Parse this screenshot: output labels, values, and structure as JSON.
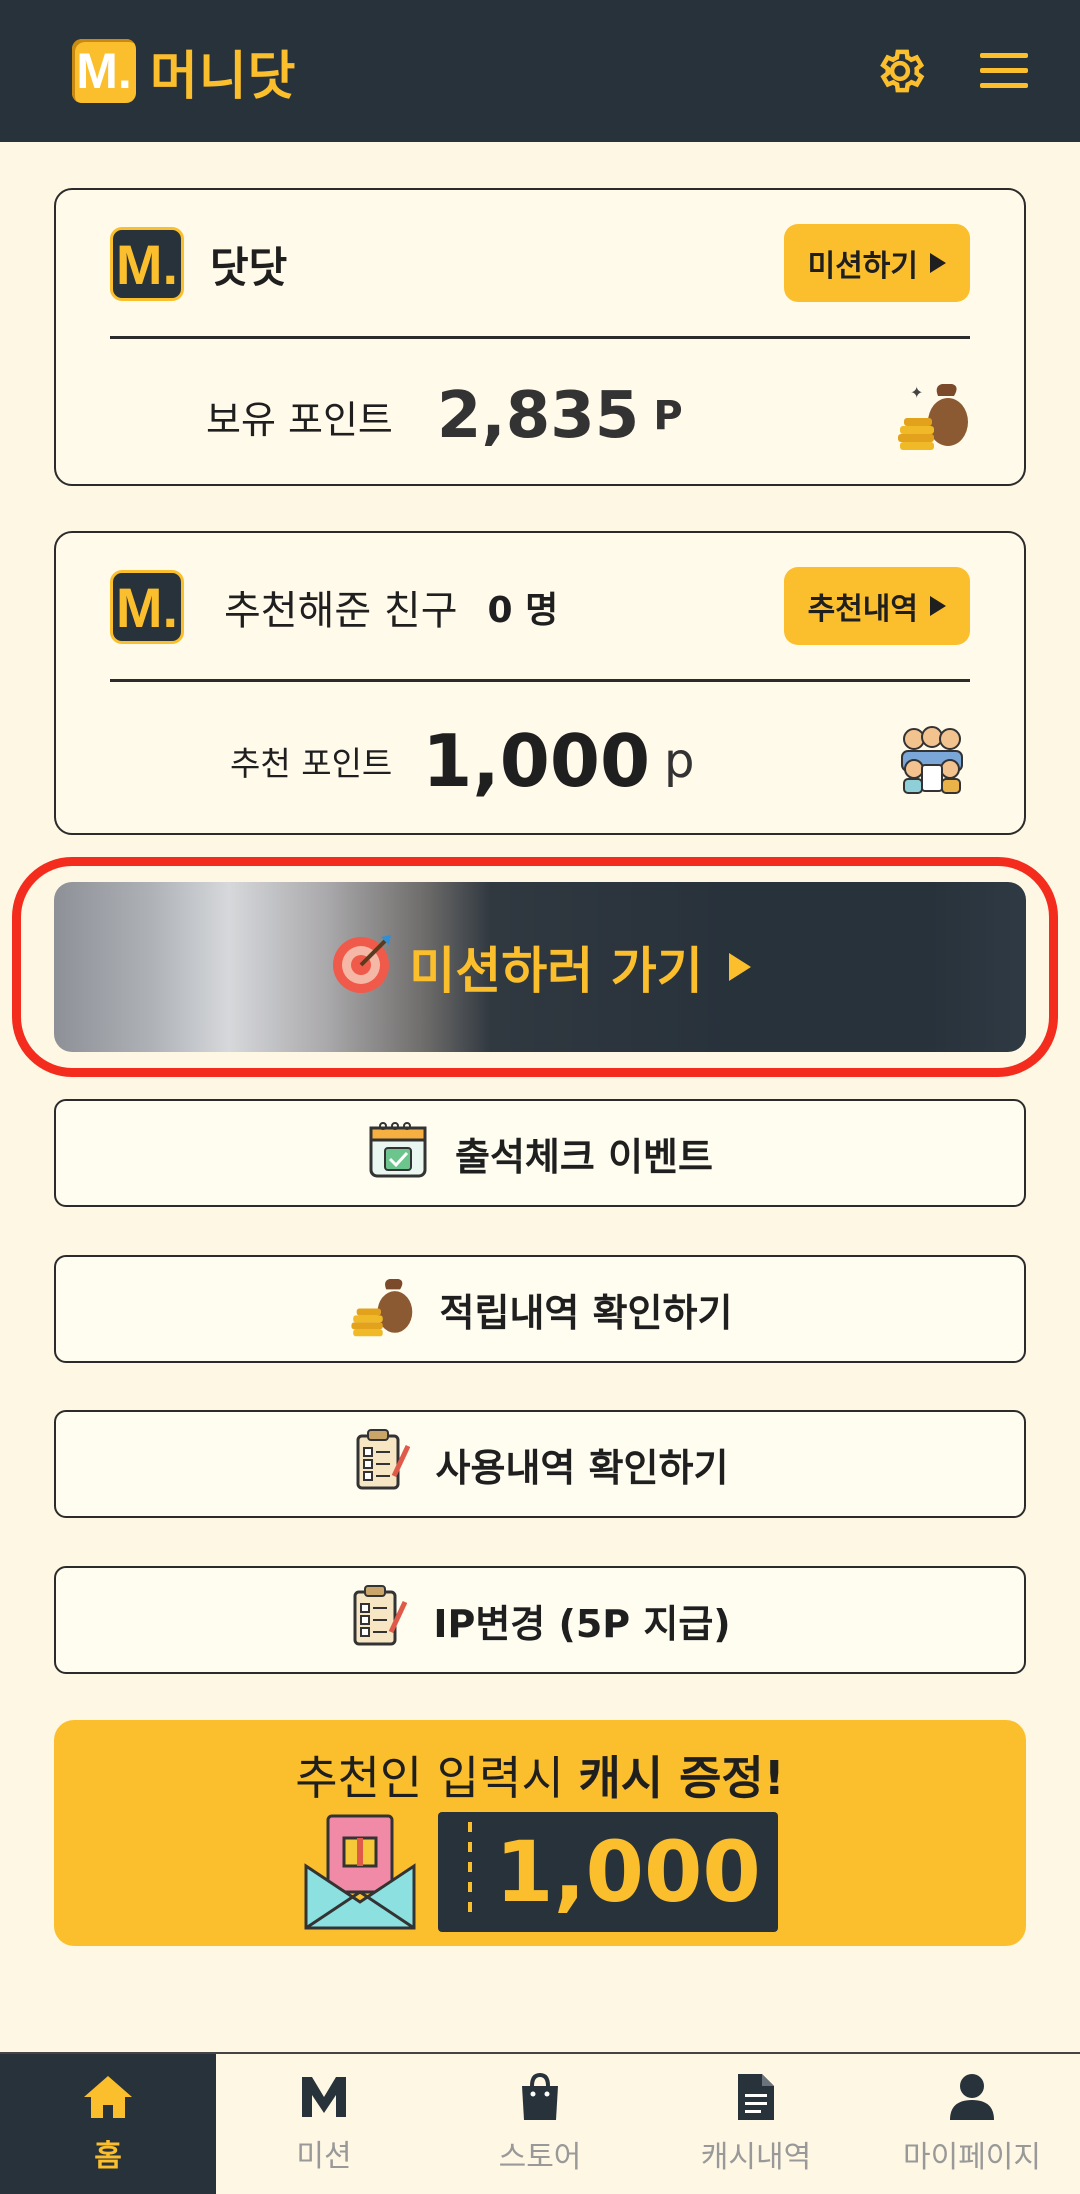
{
  "header": {
    "logo_mark": "M.",
    "app_name": "머니닷",
    "settings_icon": "gear-icon",
    "menu_icon": "hamburger-menu-icon"
  },
  "points_card": {
    "logo_mark": "M.",
    "title": "닷닷",
    "action_label": "미션하기",
    "points_label": "보유 포인트",
    "points_value": "2,835",
    "points_unit": "P",
    "illustration": "money-bag-icon"
  },
  "referral_card": {
    "logo_mark": "M.",
    "title": "추천해준 친구",
    "count_value": "0 명",
    "action_label": "추천내역",
    "points_label": "추천 포인트",
    "points_value": "1,000",
    "points_unit": "p",
    "illustration": "friends-group-icon"
  },
  "cta": {
    "label": "미션하러 가기",
    "icon": "target-dart-icon"
  },
  "menu_buttons": [
    {
      "label": "출석체크 이벤트",
      "icon": "calendar-check-icon"
    },
    {
      "label": "적립내역 확인하기",
      "icon": "money-bag-icon"
    },
    {
      "label": "사용내역 확인하기",
      "icon": "clipboard-checklist-icon"
    },
    {
      "label": "IP변경 (5P 지급)",
      "icon": "clipboard-checklist-icon"
    }
  ],
  "banner": {
    "text_normal": "추천인 입력시 ",
    "text_bold": "캐시 증정!",
    "ticket_value": "1,000",
    "icon": "gift-envelope-icon"
  },
  "bottom_nav": [
    {
      "label": "홈",
      "icon": "home-icon",
      "active": true
    },
    {
      "label": "미션",
      "icon": "m-logo-icon",
      "active": false
    },
    {
      "label": "스토어",
      "icon": "shopping-bag-icon",
      "active": false
    },
    {
      "label": "캐시내역",
      "icon": "document-icon",
      "active": false
    },
    {
      "label": "마이페이지",
      "icon": "person-icon",
      "active": false
    }
  ],
  "colors": {
    "accent": "#fbbf2d",
    "dark": "#28323b",
    "background": "#fdf7e3",
    "highlight_outline": "#f32c1e"
  }
}
